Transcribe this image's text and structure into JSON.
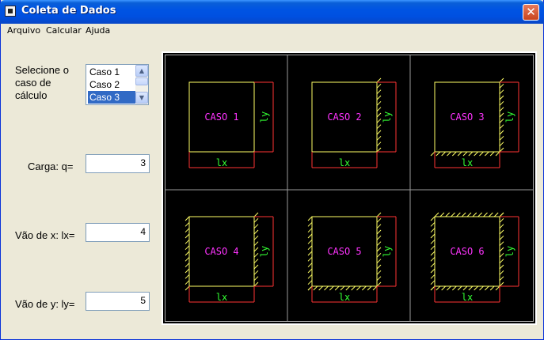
{
  "window": {
    "title": "Coleta de Dados",
    "close_glyph": "✕"
  },
  "menu": [
    {
      "label": "Arquivo"
    },
    {
      "label": "Calcular"
    },
    {
      "label": "Ajuda"
    }
  ],
  "selector": {
    "label_lines": [
      "Selecione o",
      "caso de",
      "cálculo"
    ],
    "options": [
      "Caso 1",
      "Caso 2",
      "Caso 3"
    ],
    "selected": "Caso 3"
  },
  "fields": {
    "carga": {
      "label": "Carga: q=",
      "value": "3"
    },
    "vao_x": {
      "label": "Vão de x: lx=",
      "value": "4"
    },
    "vao_y": {
      "label": "Vão de y: ly=",
      "value": "5"
    }
  },
  "cases": [
    {
      "name": "CASO 1",
      "lx": "lx",
      "ly": "ly"
    },
    {
      "name": "CASO 2",
      "lx": "lx",
      "ly": "ly"
    },
    {
      "name": "CASO 3",
      "lx": "lx",
      "ly": "ly"
    },
    {
      "name": "CASO 4",
      "lx": "lx",
      "ly": "ly"
    },
    {
      "name": "CASO 5",
      "lx": "lx",
      "ly": "ly"
    },
    {
      "name": "CASO 6",
      "lx": "lx",
      "ly": "ly"
    }
  ],
  "colors": {
    "slab": "#ffff66",
    "dimension": "#ff3333",
    "dimension_text": "#33ff33",
    "case_text": "#ff33ff",
    "grid": "#9a9a9a",
    "canvas_bg": "#000000"
  }
}
